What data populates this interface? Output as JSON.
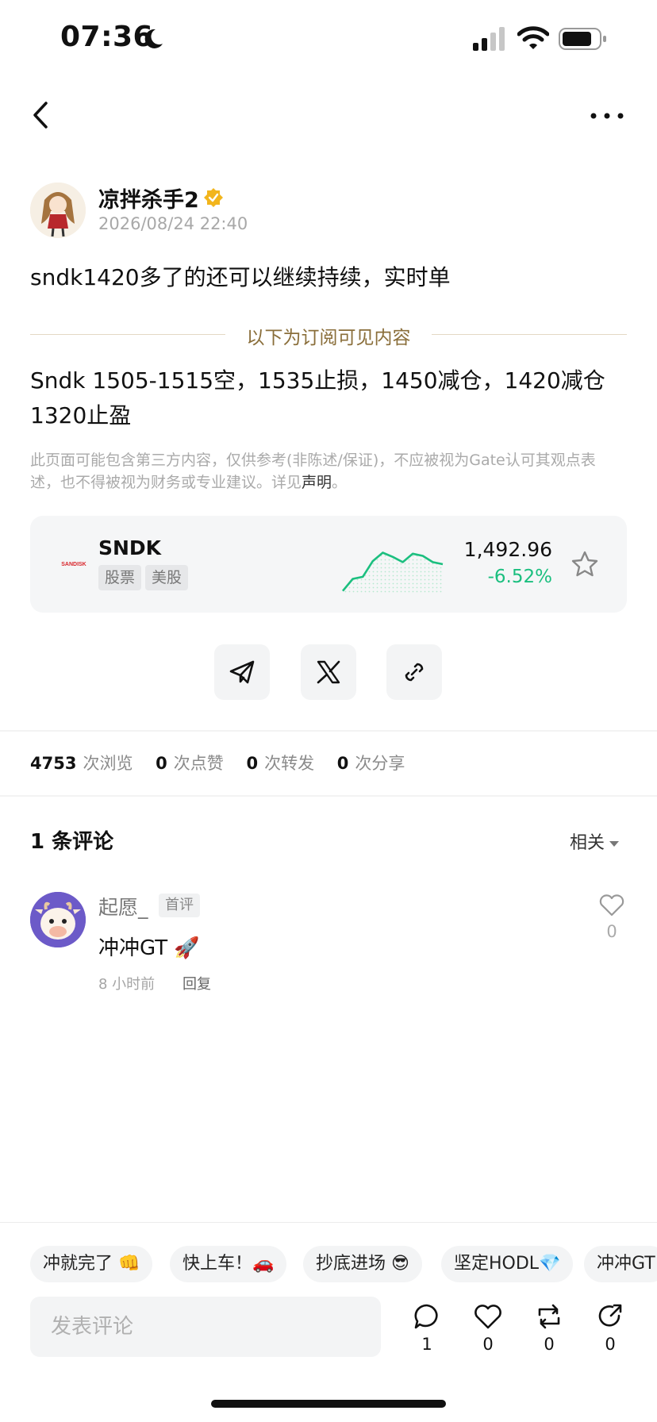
{
  "status_bar": {
    "time": "07:36"
  },
  "author": {
    "name": "凉拌杀手2",
    "time": "2026/08/24 22:40"
  },
  "post": {
    "text": "sndk1420多了的还可以继续持续，实时单",
    "subscriber_divider": "以下为订阅可见内容",
    "subscriber_line1": "Sndk 1505-1515空，1535止损，1450减仓，1420减仓",
    "subscriber_line2": "1320止盈",
    "disclaimer": "此页面可能包含第三方内容，仅供参考(非陈述/保证)，不应被视为Gate认可其观点表述，也不得被视为财务或专业建议。详见",
    "disclaimer_link": "声明",
    "disclaimer_end": "。"
  },
  "stock": {
    "logo_text": "SANDISK",
    "symbol": "SNDK",
    "tag1": "股票",
    "tag2": "美股",
    "price": "1,492.96",
    "change": "-6.52%",
    "change_color": "#1bbf7f",
    "sparkline": [
      0.05,
      0.28,
      0.32,
      0.62,
      0.78,
      0.7,
      0.6,
      0.76,
      0.72,
      0.6,
      0.56
    ]
  },
  "share": {
    "icons": [
      "telegram-icon",
      "x-icon",
      "link-icon"
    ]
  },
  "stats": {
    "views": "4753",
    "views_label": "次浏览",
    "likes": "0",
    "likes_label": "次点赞",
    "reposts": "0",
    "reposts_label": "次转发",
    "shares": "0",
    "shares_label": "次分享"
  },
  "comments": {
    "title": "1 条评论",
    "sort": "相关",
    "items": [
      {
        "name": "起愿_",
        "badge": "首评",
        "text": "冲冲GT 🚀",
        "time": "8 小时前",
        "reply": "回复",
        "likes": "0"
      }
    ]
  },
  "quick_replies": [
    "冲就完了 👊",
    "快上车！🚗",
    "抄底进场 😎",
    "坚定HODL💎",
    "冲冲GT"
  ],
  "bottom_bar": {
    "input_placeholder": "发表评论",
    "comments_count": "1",
    "likes_count": "0",
    "reposts_count": "0",
    "shares_count": "0"
  }
}
